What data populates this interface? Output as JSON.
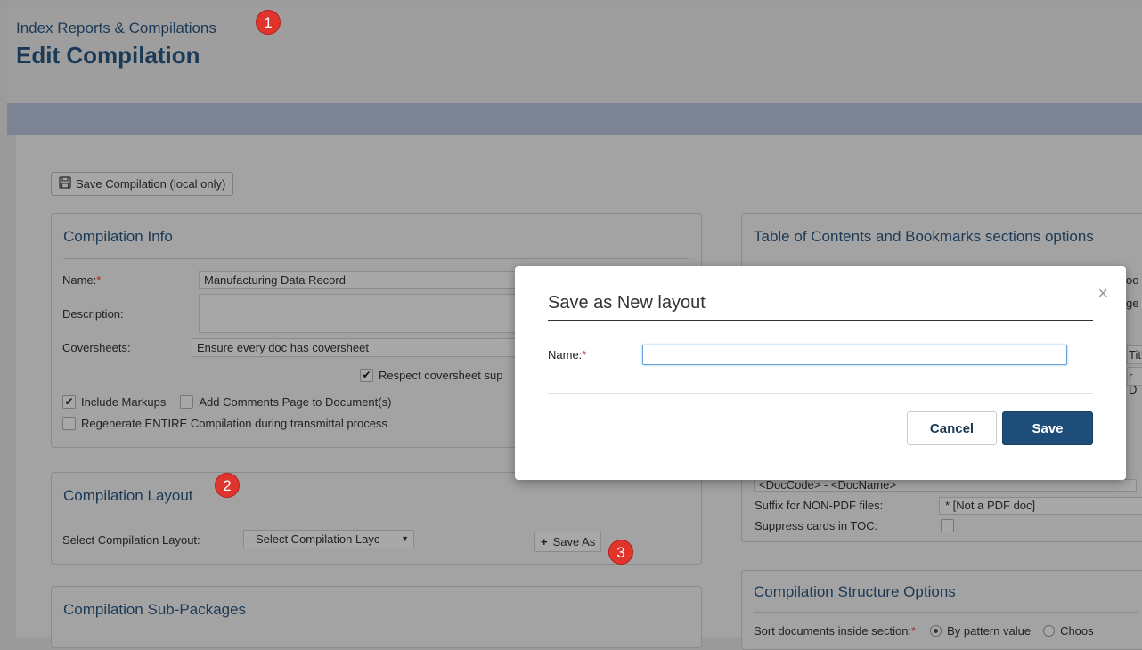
{
  "header": {
    "breadcrumb": "Index Reports & Compilations",
    "title": "Edit Compilation",
    "badges": [
      "1",
      "2",
      "3"
    ]
  },
  "toolbar": {
    "save_compilation_label": "Save Compilation (local only)"
  },
  "compilation_info": {
    "title": "Compilation Info",
    "name_label": "Name:",
    "name_value": "Manufacturing Data Record",
    "description_label": "Description:",
    "coversheets_label": "Coversheets:",
    "coversheets_value": "Ensure every doc has coversheet",
    "respect_coversheet_label": "Respect coversheet sup",
    "include_markups_label": "Include Markups",
    "add_comments_label": "Add Comments Page to Document(s)",
    "regenerate_label": "Regenerate ENTIRE Compilation during transmittal process"
  },
  "compilation_layout": {
    "title": "Compilation Layout",
    "select_label": "Select Compilation Layout:",
    "select_value": "- Select Compilation Layc",
    "save_as_label": "Save As"
  },
  "sub_packages": {
    "title": "Compilation Sub-Packages"
  },
  "toc": {
    "title": "Table of Contents and Bookmarks sections options",
    "right_edge_1": "oo",
    "right_edge_2": "ge",
    "right_edge_3": "Titl",
    "right_edge_4": "r D",
    "pattern_value": "<DocCode> - <DocName>",
    "suffix_label": "Suffix for NON-PDF files:",
    "suffix_value": "* [Not a PDF doc]",
    "suppress_label": "Suppress cards in TOC:"
  },
  "structure": {
    "title": "Compilation Structure Options",
    "sort_label": "Sort documents inside section:",
    "option_pattern": "By pattern value",
    "option_choose": "Choos"
  },
  "modal": {
    "title": "Save as New layout",
    "close_glyph": "×",
    "name_label": "Name:",
    "name_value": "",
    "cancel_label": "Cancel",
    "save_label": "Save"
  },
  "colors": {
    "heading": "#1b3a57",
    "badge": "#e0352d",
    "primary_button": "#1f4d7a"
  }
}
